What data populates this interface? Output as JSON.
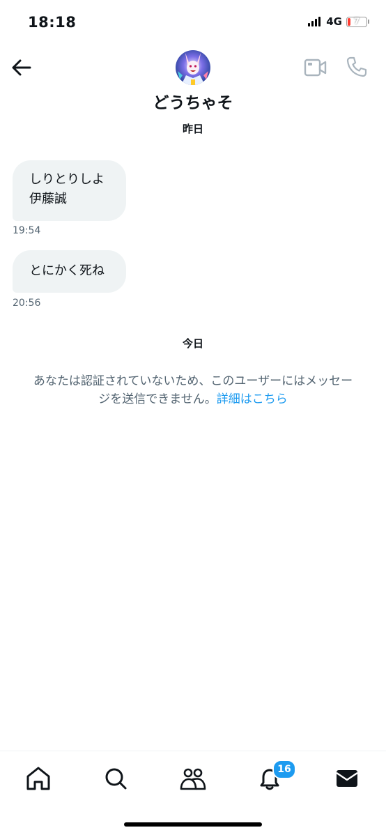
{
  "status_bar": {
    "time": "18:18",
    "network": "4G",
    "battery": "7"
  },
  "header": {
    "contact_name": "どうちゃそ",
    "icons": [
      "back-arrow-icon",
      "avatar",
      "video-call-icon",
      "phone-call-icon"
    ]
  },
  "conversation": {
    "yesterday_label": "昨日",
    "messages": [
      {
        "lines": [
          "しりとりしよ",
          "伊藤誠"
        ],
        "time": "19:54"
      },
      {
        "lines": [
          "とにかく死ね"
        ],
        "time": "20:56"
      }
    ],
    "today_label": "今日"
  },
  "notice": {
    "line1": "あなたは認証されていないため、このユーザーにはメッセー",
    "line2": "ジを送信できません。",
    "link": "詳細はこちら"
  },
  "bottom_nav": {
    "items": [
      "home-icon",
      "search-icon",
      "communities-icon",
      "notifications-icon",
      "messages-icon"
    ],
    "notification_badge": "16"
  },
  "colors": {
    "accent": "#1d9bf0",
    "bubble": "#eff3f4",
    "secondary_text": "#536471",
    "battery_low": "#ff3b30"
  }
}
